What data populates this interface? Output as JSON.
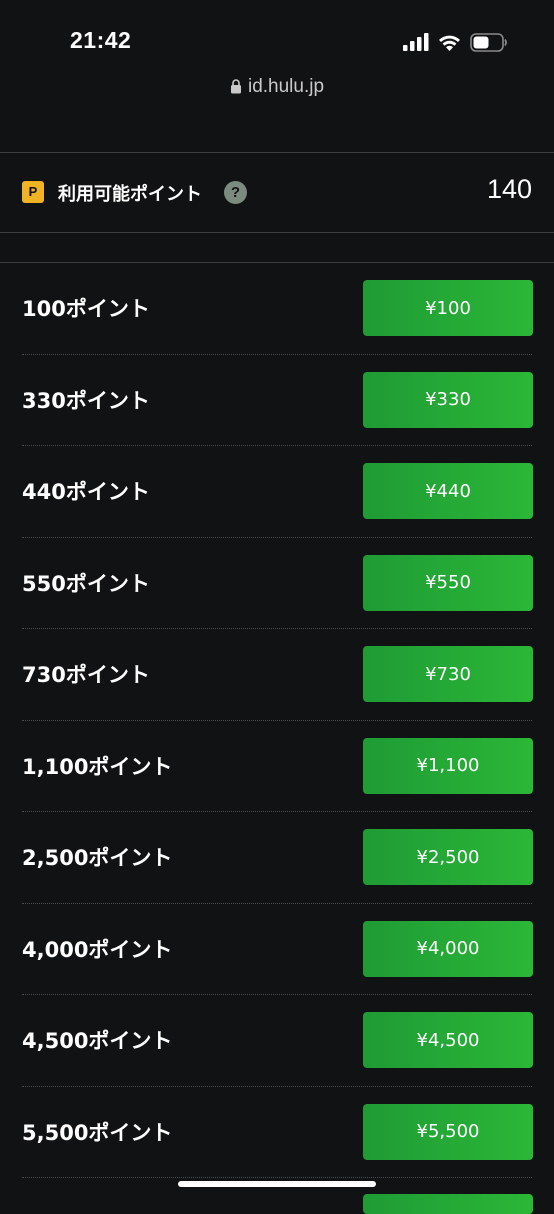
{
  "status_bar": {
    "time": "21:42",
    "icons": [
      "signal-icon",
      "wifi-icon",
      "battery-icon"
    ]
  },
  "browser": {
    "url": "id.hulu.jp"
  },
  "points": {
    "badge": "P",
    "label": "利用可能ポイント",
    "help": "?",
    "value": "140"
  },
  "plans": [
    {
      "label": "100ポイント",
      "price": "¥100"
    },
    {
      "label": "330ポイント",
      "price": "¥330"
    },
    {
      "label": "440ポイント",
      "price": "¥440"
    },
    {
      "label": "550ポイント",
      "price": "¥550"
    },
    {
      "label": "730ポイント",
      "price": "¥730"
    },
    {
      "label": "1,100ポイント",
      "price": "¥1,100"
    },
    {
      "label": "2,500ポイント",
      "price": "¥2,500"
    },
    {
      "label": "4,000ポイント",
      "price": "¥4,000"
    },
    {
      "label": "4,500ポイント",
      "price": "¥4,500"
    },
    {
      "label": "5,500ポイント",
      "price": "¥5,500"
    }
  ],
  "colors": {
    "background": "#111213",
    "accent_green": "#2bb737",
    "badge_yellow": "#f0b323",
    "help_gray": "#7c8b80"
  }
}
